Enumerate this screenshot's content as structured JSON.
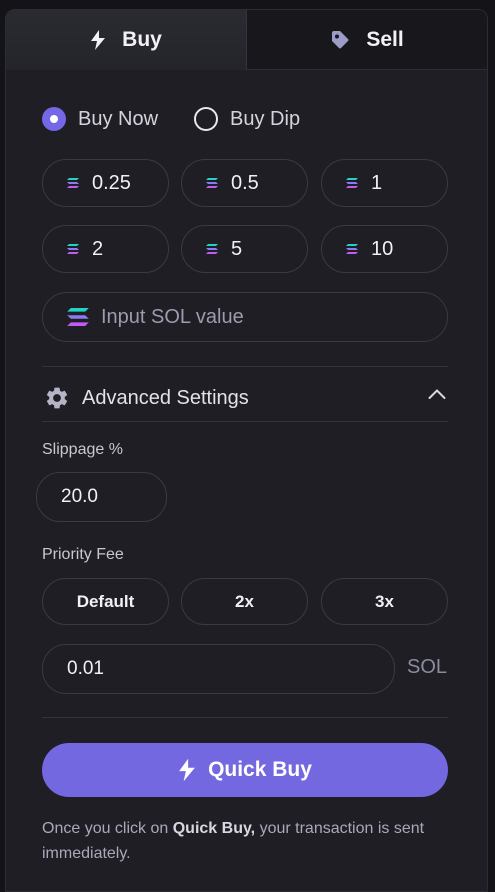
{
  "tabs": {
    "buy": "Buy",
    "sell": "Sell"
  },
  "mode": {
    "buy_now": "Buy Now",
    "buy_dip": "Buy Dip",
    "selected": "Buy Now"
  },
  "amounts": [
    "0.25",
    "0.5",
    "1",
    "2",
    "5",
    "10"
  ],
  "sol_input": {
    "placeholder": "Input SOL value"
  },
  "advanced": {
    "title": "Advanced Settings",
    "expanded": true
  },
  "slippage": {
    "label": "Slippage %",
    "value": "20.0"
  },
  "priority_fee": {
    "label": "Priority Fee",
    "options": [
      "Default",
      "2x",
      "3x"
    ],
    "value": "0.01",
    "unit": "SOL"
  },
  "quick_buy": {
    "label": "Quick Buy"
  },
  "note": {
    "prefix": "Once you click on ",
    "emphasis": "Quick Buy,",
    "suffix": " your transaction is sent immediately."
  },
  "colors": {
    "accent": "#7468e0",
    "background": "#1e1e24",
    "border": "#3a3a44"
  },
  "icons": {
    "buy": "lightning-icon",
    "sell": "tag-icon",
    "amount": "solana-icon",
    "settings": "gear-icon",
    "collapse": "chevron-up-icon"
  }
}
